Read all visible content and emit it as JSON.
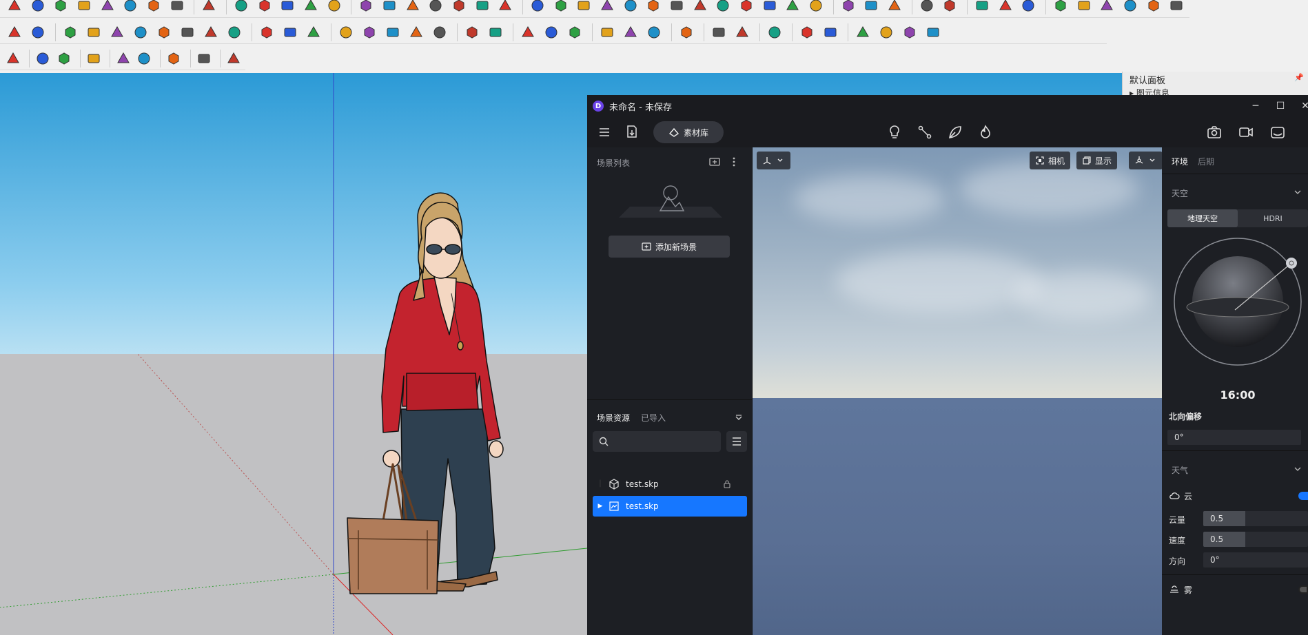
{
  "sketchup": {
    "tray": {
      "title": "默认面板",
      "item": "▸ 图元信息"
    }
  },
  "d5": {
    "window_title": "未命名 - 未保存",
    "window_controls": {
      "minimize": "─",
      "maximize": "☐",
      "close": "✕"
    },
    "toolbar": {
      "library_label": "素材库"
    },
    "left_panel": {
      "scene_list_title": "场景列表",
      "add_scene_label": "添加新场景",
      "resource_tabs": [
        "场景资源",
        "已导入"
      ],
      "search_placeholder": "",
      "tree": [
        {
          "label": "test.skp",
          "selected": false
        },
        {
          "label": "test.skp",
          "selected": true
        }
      ]
    },
    "viewport": {
      "camera_label": "相机",
      "display_label": "显示"
    },
    "right_panel": {
      "tabs": [
        "环境",
        "后期"
      ],
      "sky_title": "天空",
      "sky_modes": [
        "地理天空",
        "HDRI"
      ],
      "time": "16:00",
      "north_offset_label": "北向偏移",
      "north_offset_value": "0°",
      "weather_title": "天气",
      "cloud_label": "云",
      "cloud_amount_label": "云量",
      "cloud_amount_value": "0.5",
      "cloud_amount_fraction": 0.4,
      "speed_label": "速度",
      "speed_value": "0.5",
      "speed_fraction": 0.4,
      "direction_label": "方向",
      "direction_value": "0°",
      "fog_label": "雾"
    }
  },
  "colors": {
    "accent": "#1677ff",
    "d5_bg": "#1d1f24",
    "shirt": "#c3232e",
    "pants": "#2e4050",
    "bag": "#b07c5a"
  }
}
